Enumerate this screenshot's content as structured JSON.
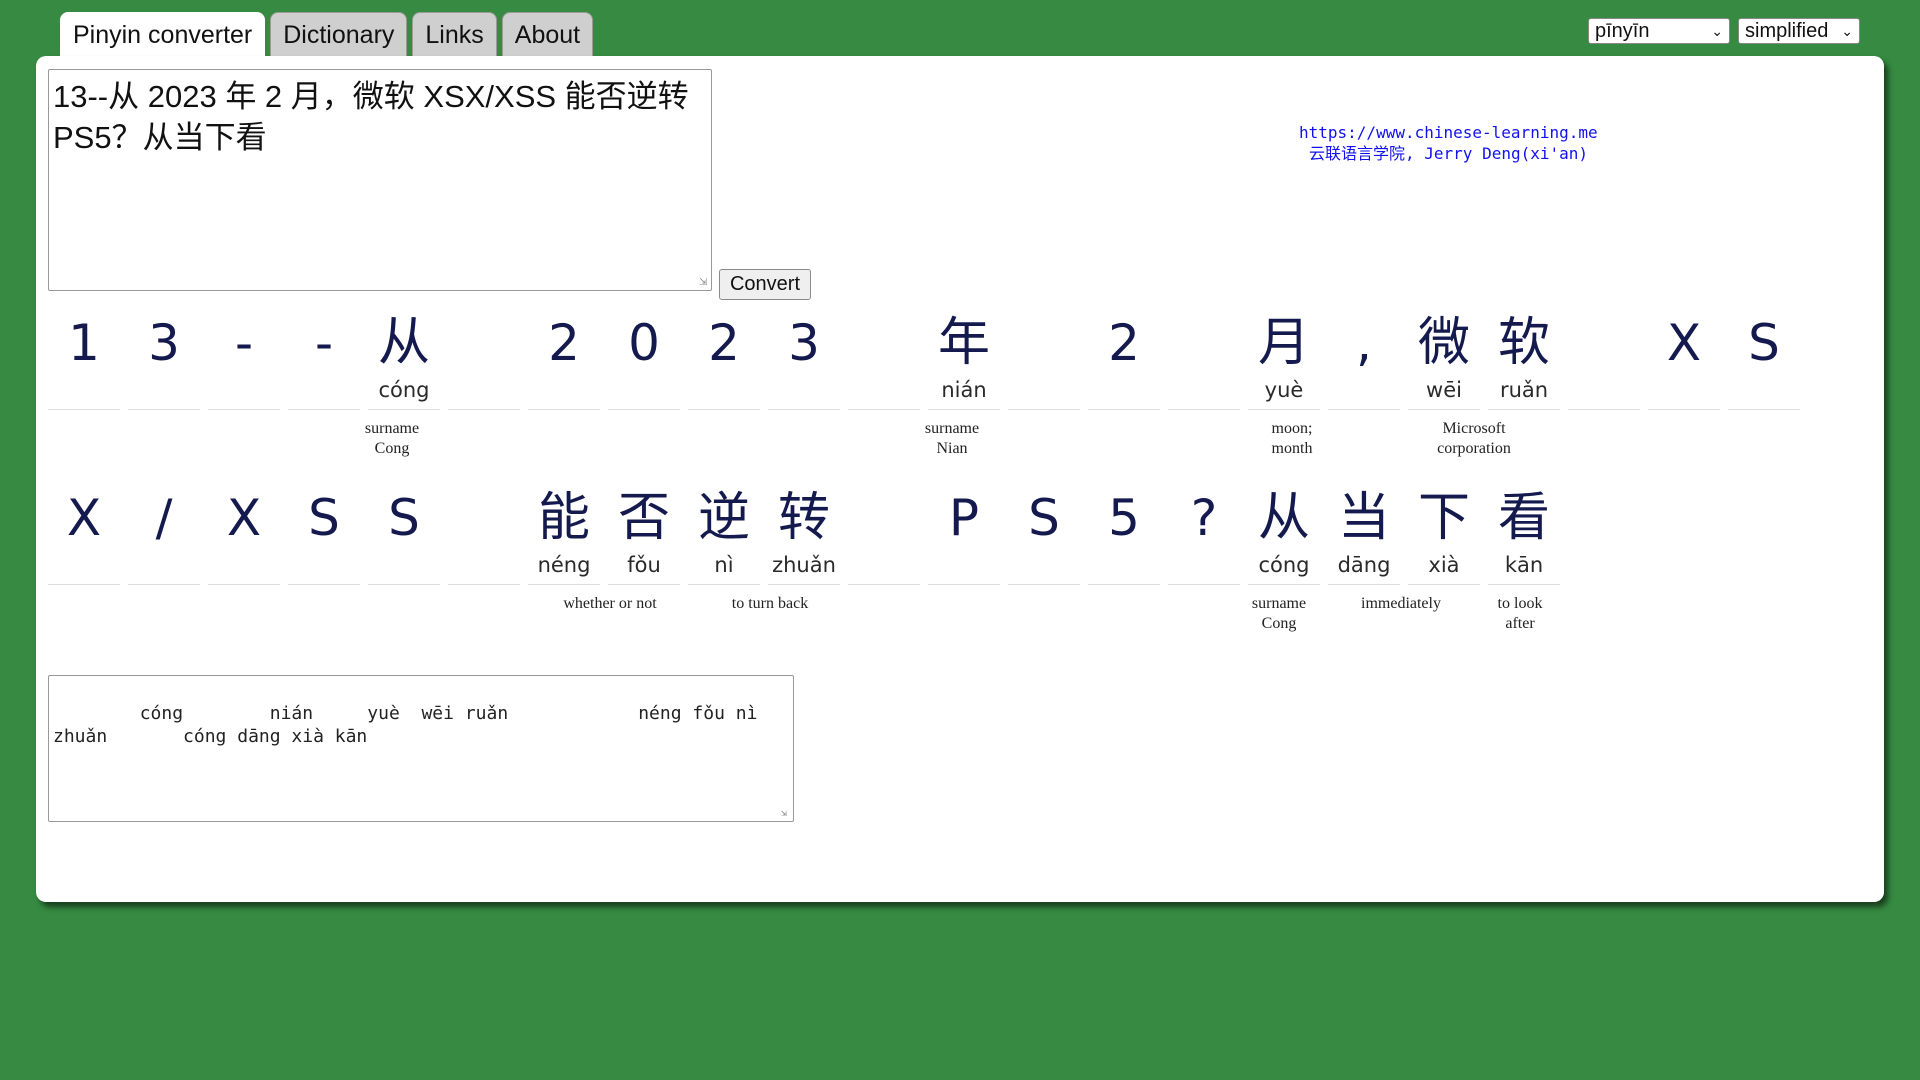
{
  "tabs": [
    {
      "label": "Pinyin converter",
      "active": true
    },
    {
      "label": "Dictionary",
      "active": false
    },
    {
      "label": "Links",
      "active": false
    },
    {
      "label": "About",
      "active": false
    }
  ],
  "selects": {
    "pronunciation": "pīnyīn",
    "script": "simplified"
  },
  "input": {
    "value": "13--从 2023 年 2 月，微软 XSX/XSS 能否逆转 PS5？从当下看"
  },
  "convert_label": "Convert",
  "credit": {
    "url": "https://www.chinese-learning.me",
    "author": "云联语言学院, Jerry Deng(xi'an)"
  },
  "row1": [
    {
      "char": "1",
      "py": ""
    },
    {
      "char": "3",
      "py": ""
    },
    {
      "char": "-",
      "py": ""
    },
    {
      "char": "-",
      "py": ""
    },
    {
      "char": "从",
      "py": "cóng"
    },
    {
      "char": "",
      "py": ""
    },
    {
      "char": "2",
      "py": ""
    },
    {
      "char": "0",
      "py": ""
    },
    {
      "char": "2",
      "py": ""
    },
    {
      "char": "3",
      "py": ""
    },
    {
      "char": "",
      "py": ""
    },
    {
      "char": "年",
      "py": "nián"
    },
    {
      "char": "",
      "py": ""
    },
    {
      "char": "2",
      "py": ""
    },
    {
      "char": "",
      "py": ""
    },
    {
      "char": "月",
      "py": "yuè"
    },
    {
      "char": ",",
      "py": ""
    },
    {
      "char": "微",
      "py": "wēi"
    },
    {
      "char": "软",
      "py": "ruǎn"
    },
    {
      "char": "",
      "py": ""
    },
    {
      "char": "X",
      "py": ""
    },
    {
      "char": "S",
      "py": ""
    }
  ],
  "row1_glosses": [
    {
      "text": "surname Cong"
    },
    {
      "text": "surname Nian"
    },
    {
      "text": "moon; month"
    },
    {
      "text": "Microsoft corporation"
    }
  ],
  "row2": [
    {
      "char": "X",
      "py": ""
    },
    {
      "char": "/",
      "py": ""
    },
    {
      "char": "X",
      "py": ""
    },
    {
      "char": "S",
      "py": ""
    },
    {
      "char": "S",
      "py": ""
    },
    {
      "char": "",
      "py": ""
    },
    {
      "char": "能",
      "py": "néng"
    },
    {
      "char": "否",
      "py": "fǒu"
    },
    {
      "char": "逆",
      "py": "nì"
    },
    {
      "char": "转",
      "py": "zhuǎn"
    },
    {
      "char": "",
      "py": ""
    },
    {
      "char": "P",
      "py": ""
    },
    {
      "char": "S",
      "py": ""
    },
    {
      "char": "5",
      "py": ""
    },
    {
      "char": "?",
      "py": ""
    },
    {
      "char": "从",
      "py": "cóng"
    },
    {
      "char": "当",
      "py": "dāng"
    },
    {
      "char": "下",
      "py": "xià"
    },
    {
      "char": "看",
      "py": "kān"
    }
  ],
  "row2_glosses": [
    {
      "text": "whether or not"
    },
    {
      "text": "to turn back"
    },
    {
      "text": "surname Cong"
    },
    {
      "text": "immediately"
    },
    {
      "text": "to look after"
    }
  ],
  "output": {
    "value": "    cóng        nián     yuè  wēi ruǎn            néng fǒu nì zhuǎn       cóng dāng xià kān"
  }
}
